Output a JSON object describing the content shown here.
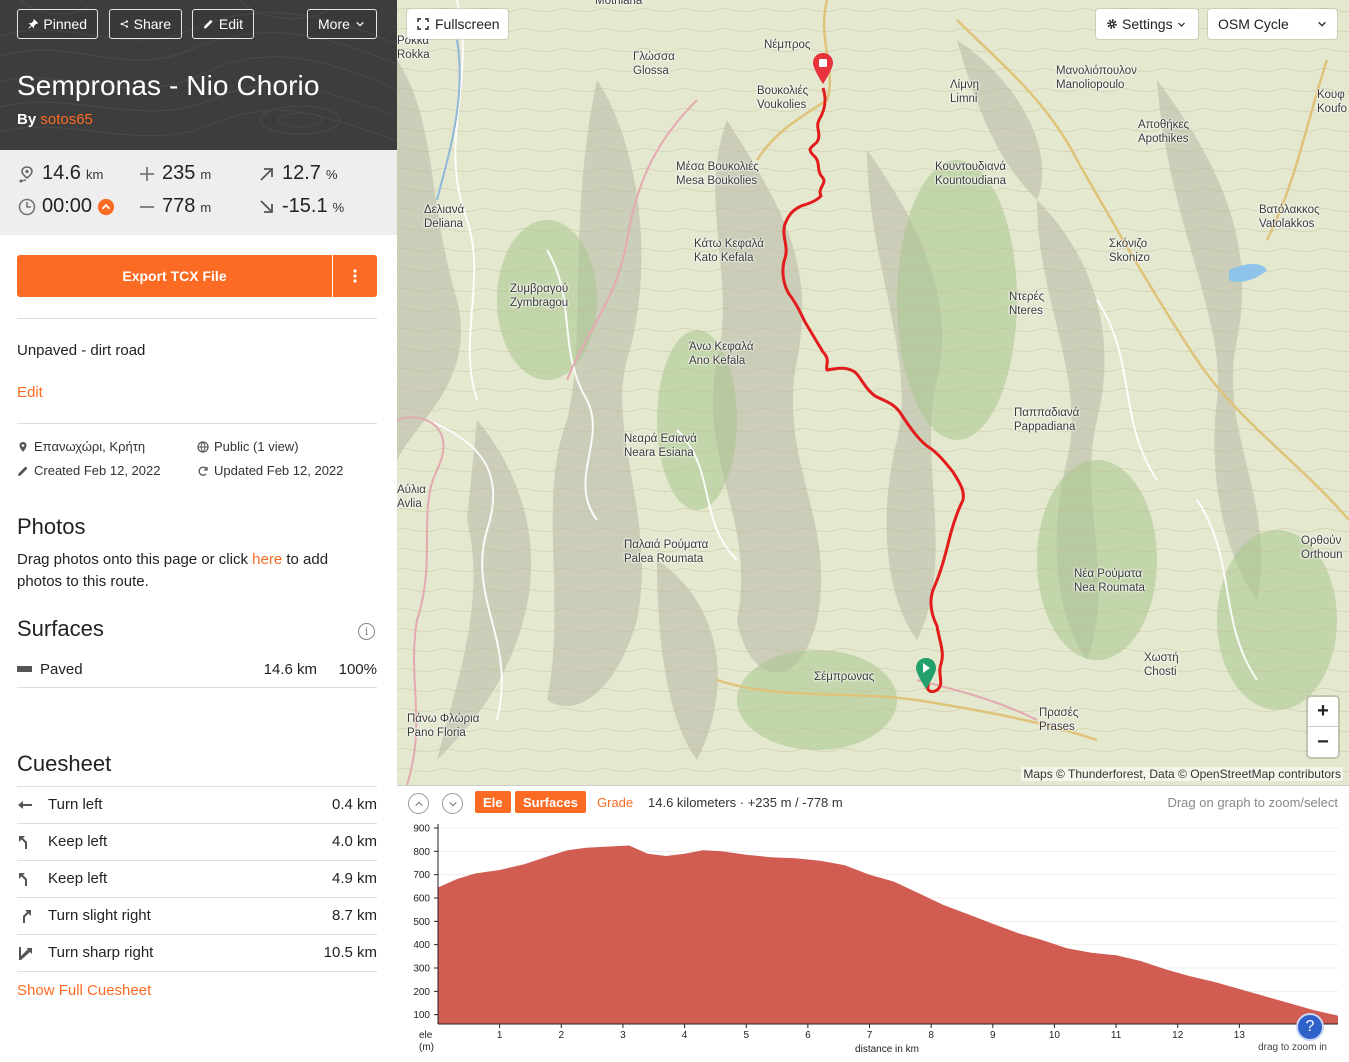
{
  "header": {
    "buttons": {
      "pinned": "Pinned",
      "share": "Share",
      "edit": "Edit",
      "more": "More"
    },
    "title": "Sempronas - Nio Chorio",
    "by_prefix": "By",
    "author": "sotos65"
  },
  "stats": {
    "distance": {
      "value": "14.6",
      "unit": "km"
    },
    "elevation_gain": {
      "value": "235",
      "unit": "m"
    },
    "max_grade": {
      "value": "12.7",
      "unit": "%"
    },
    "duration": {
      "value": "00:00"
    },
    "elevation_loss": {
      "value": "778",
      "unit": "m"
    },
    "min_grade": {
      "value": "-15.1",
      "unit": "%"
    }
  },
  "export": {
    "label": "Export TCX File"
  },
  "description": "Unpaved - dirt road",
  "edit_link": "Edit",
  "meta": {
    "location": "Επανωχώρι, Κρήτη",
    "visibility": "Public (1 view)",
    "created": "Created Feb 12, 2022",
    "updated": "Updated Feb 12, 2022"
  },
  "photos": {
    "heading": "Photos",
    "text_before": "Drag photos onto this page or click ",
    "link": "here",
    "text_after": " to add photos to this route."
  },
  "surfaces": {
    "heading": "Surfaces",
    "rows": [
      {
        "name": "Paved",
        "distance": "14.6 km",
        "percent": "100%",
        "color": "#555555"
      }
    ]
  },
  "cuesheet": {
    "heading": "Cuesheet",
    "rows": [
      {
        "label": "Turn left",
        "distance": "0.4 km",
        "icon": "turn-left-icon"
      },
      {
        "label": "Keep left",
        "distance": "4.0 km",
        "icon": "keep-left-icon"
      },
      {
        "label": "Keep left",
        "distance": "4.9 km",
        "icon": "keep-left-icon"
      },
      {
        "label": "Turn slight right",
        "distance": "8.7 km",
        "icon": "slight-right-icon"
      },
      {
        "label": "Turn sharp right",
        "distance": "10.5 km",
        "icon": "sharp-right-icon"
      }
    ],
    "show_full": "Show Full Cuesheet"
  },
  "map": {
    "fullscreen": "Fullscreen",
    "settings": "Settings",
    "layer": "OSM Cycle",
    "attribution": "Maps © Thunderforest, Data © OpenStreetMap contributors",
    "route_color": "#e21b1b",
    "start_color": "#22a06b",
    "end_color": "#e8323c",
    "places": [
      {
        "id": "nempros",
        "text": "Νέμπρος"
      },
      {
        "id": "glossa",
        "text": "Γλώσσα\nGlossa"
      },
      {
        "id": "voukolies",
        "text": "Βουκολιές\nVoukolies"
      },
      {
        "id": "limni",
        "text": "Λίμνη\nLimni"
      },
      {
        "id": "manoliopoulo",
        "text": "Μανολιόπουλον\nManoliopoulo"
      },
      {
        "id": "rokka",
        "text": "Ρόκκα\nRokka"
      },
      {
        "id": "apothikes",
        "text": "Αποθήκες\nApothikes"
      },
      {
        "id": "mesa-voukolies",
        "text": "Μέσα Βουκολιές\nMesa Boukolies"
      },
      {
        "id": "kountoudiana",
        "text": "Κουντουδιανά\nKountoudiana"
      },
      {
        "id": "deliana",
        "text": "Δελιανά\nDeliana"
      },
      {
        "id": "vatolakkos",
        "text": "Βατόλακκος\nVatolakkos"
      },
      {
        "id": "kato-kefala",
        "text": "Κάτω Κεφαλά\nKato Kefala"
      },
      {
        "id": "skonizo",
        "text": "Σκόνιζο\nSkonizo"
      },
      {
        "id": "zymbragou",
        "text": "Ζυμβραγού\nZymbragou"
      },
      {
        "id": "nteres",
        "text": "Ντερές\nNteres"
      },
      {
        "id": "ano-kefala",
        "text": "Άνω Κεφαλά\nAno Kefala"
      },
      {
        "id": "pappadiana",
        "text": "Παππαδιανά\nPappadiana"
      },
      {
        "id": "neara-esiana",
        "text": "Νεαρά Εσιανά\nNeara Esiana"
      },
      {
        "id": "avlia",
        "text": "Αύλια\nAvlia"
      },
      {
        "id": "palea-roumata",
        "text": "Παλαιά Ρούματα\nPalea Roumata"
      },
      {
        "id": "orthouni",
        "text": "Ορθούν\nOrthoun"
      },
      {
        "id": "nea-roumata",
        "text": "Νέα Ρούματα\nNea Roumata"
      },
      {
        "id": "chosti",
        "text": "Χωστή\nChosti"
      },
      {
        "id": "sempronas",
        "text": "Σέμπρωνας"
      },
      {
        "id": "prases",
        "text": "Πρασές\nPrases"
      },
      {
        "id": "pano-floria",
        "text": "Πάνω Φλώρια\nPano Floria"
      },
      {
        "id": "koufi",
        "text": "Κουφ\nKoufo"
      },
      {
        "id": "mothiana",
        "text": "Mothiana"
      }
    ]
  },
  "elevation": {
    "tabs": {
      "ele": "Ele",
      "surfaces": "Surfaces",
      "grade": "Grade"
    },
    "summary": "14.6 kilometers · +235 m / -778 m",
    "hint": "Drag on graph to zoom/select",
    "xlabel": "distance in km",
    "ylabel_top": "ele",
    "ylabel_bottom": "(m)",
    "zoom_hint": "drag to zoom in",
    "help": "?"
  },
  "chart_data": {
    "type": "area",
    "xlabel": "distance in km",
    "ylabel": "ele (m)",
    "xlim": [
      0,
      14.6
    ],
    "ylim": [
      60,
      900
    ],
    "x_ticks": [
      1,
      2,
      3,
      4,
      5,
      6,
      7,
      8,
      9,
      10,
      11,
      12,
      13
    ],
    "y_ticks": [
      100,
      200,
      300,
      400,
      500,
      600,
      700,
      800,
      900
    ],
    "fill_color": "#d05c52",
    "series": [
      {
        "x": [
          0,
          0.3,
          0.6,
          1.0,
          1.4,
          1.8,
          2.1,
          2.4,
          2.7,
          3.1,
          3.4,
          3.7,
          4.0,
          4.3,
          4.6,
          5.0,
          5.4,
          5.8,
          6.2,
          6.6,
          7.0,
          7.4,
          7.8,
          8.2,
          8.6,
          9.0,
          9.4,
          9.8,
          10.2,
          10.6,
          11.0,
          11.4,
          11.8,
          12.2,
          12.6,
          13.0,
          13.4,
          13.8,
          14.2,
          14.6
        ],
        "y": [
          645,
          680,
          705,
          720,
          745,
          780,
          805,
          815,
          820,
          825,
          790,
          780,
          790,
          805,
          800,
          785,
          775,
          770,
          760,
          740,
          700,
          670,
          620,
          570,
          530,
          490,
          450,
          420,
          385,
          365,
          355,
          330,
          295,
          265,
          240,
          210,
          180,
          150,
          120,
          95
        ]
      }
    ]
  }
}
